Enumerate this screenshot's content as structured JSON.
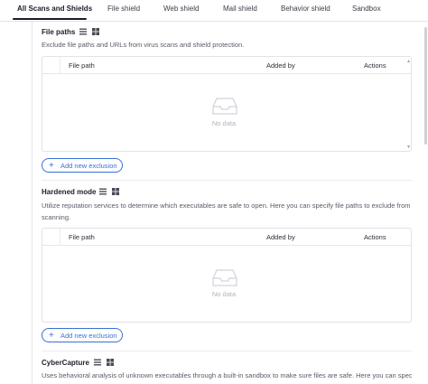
{
  "tabs": [
    {
      "label": "All Scans and Shields",
      "active": true
    },
    {
      "label": "File shield"
    },
    {
      "label": "Web shield"
    },
    {
      "label": "Mail shield"
    },
    {
      "label": "Behavior shield"
    },
    {
      "label": "Sandbox"
    }
  ],
  "sections": [
    {
      "title": "File paths",
      "description": "Exclude file paths and URLs from virus scans and shield protection.",
      "columns": [
        "File path",
        "Added by",
        "Actions"
      ],
      "empty_text": "No data",
      "add_button": "Add new exclusion"
    },
    {
      "title": "Hardened mode",
      "description": "Utilize reputation services to determine which executables are safe to open. Here you can specify file paths to exclude from scanning.",
      "columns": [
        "File path",
        "Added by",
        "Actions"
      ],
      "empty_text": "No data",
      "add_button": "Add new exclusion"
    },
    {
      "title": "CyberCapture",
      "description": "Uses behavioral analysis of unknown executables through a built-in sandbox to make sure files are safe. Here you can specify"
    }
  ],
  "icons": {
    "list": "list-icon",
    "windows": "windows-icon",
    "empty_box": "empty-inbox-icon",
    "plus": "plus-icon"
  },
  "colors": {
    "accent": "#3a6fd8",
    "text": "#1f1f2b",
    "muted": "#5a5a68",
    "border": "#e2e2e8"
  }
}
